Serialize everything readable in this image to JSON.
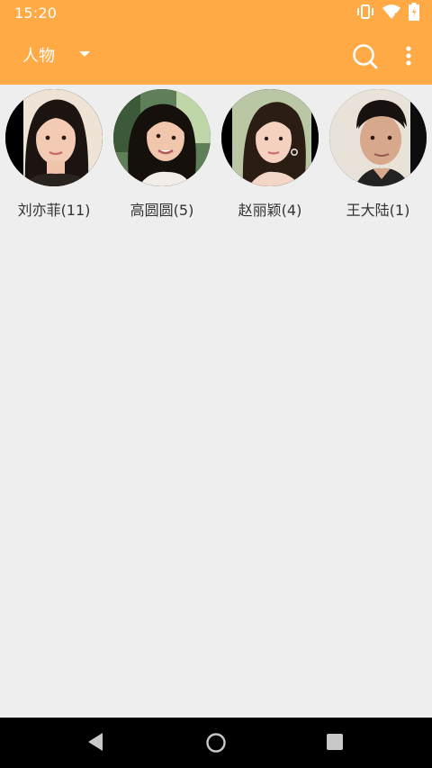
{
  "status_bar": {
    "time": "15:20",
    "icons": [
      "vibrate-icon",
      "wifi-icon",
      "battery-icon"
    ]
  },
  "app_bar": {
    "title": "人物",
    "icons": [
      "dropdown-arrow-icon",
      "search-icon",
      "more-vert-icon"
    ]
  },
  "people": [
    {
      "label": "刘亦菲(11)"
    },
    {
      "label": "高圆圆(5)"
    },
    {
      "label": "赵丽颖(4)"
    },
    {
      "label": "王大陆(1)"
    }
  ],
  "nav_bar": {
    "icons": [
      "back-icon",
      "home-icon",
      "recents-icon"
    ]
  },
  "colors": {
    "accent": "#ffaa45",
    "background": "#eeeeee",
    "navbar": "#000000",
    "text": "#333333"
  }
}
